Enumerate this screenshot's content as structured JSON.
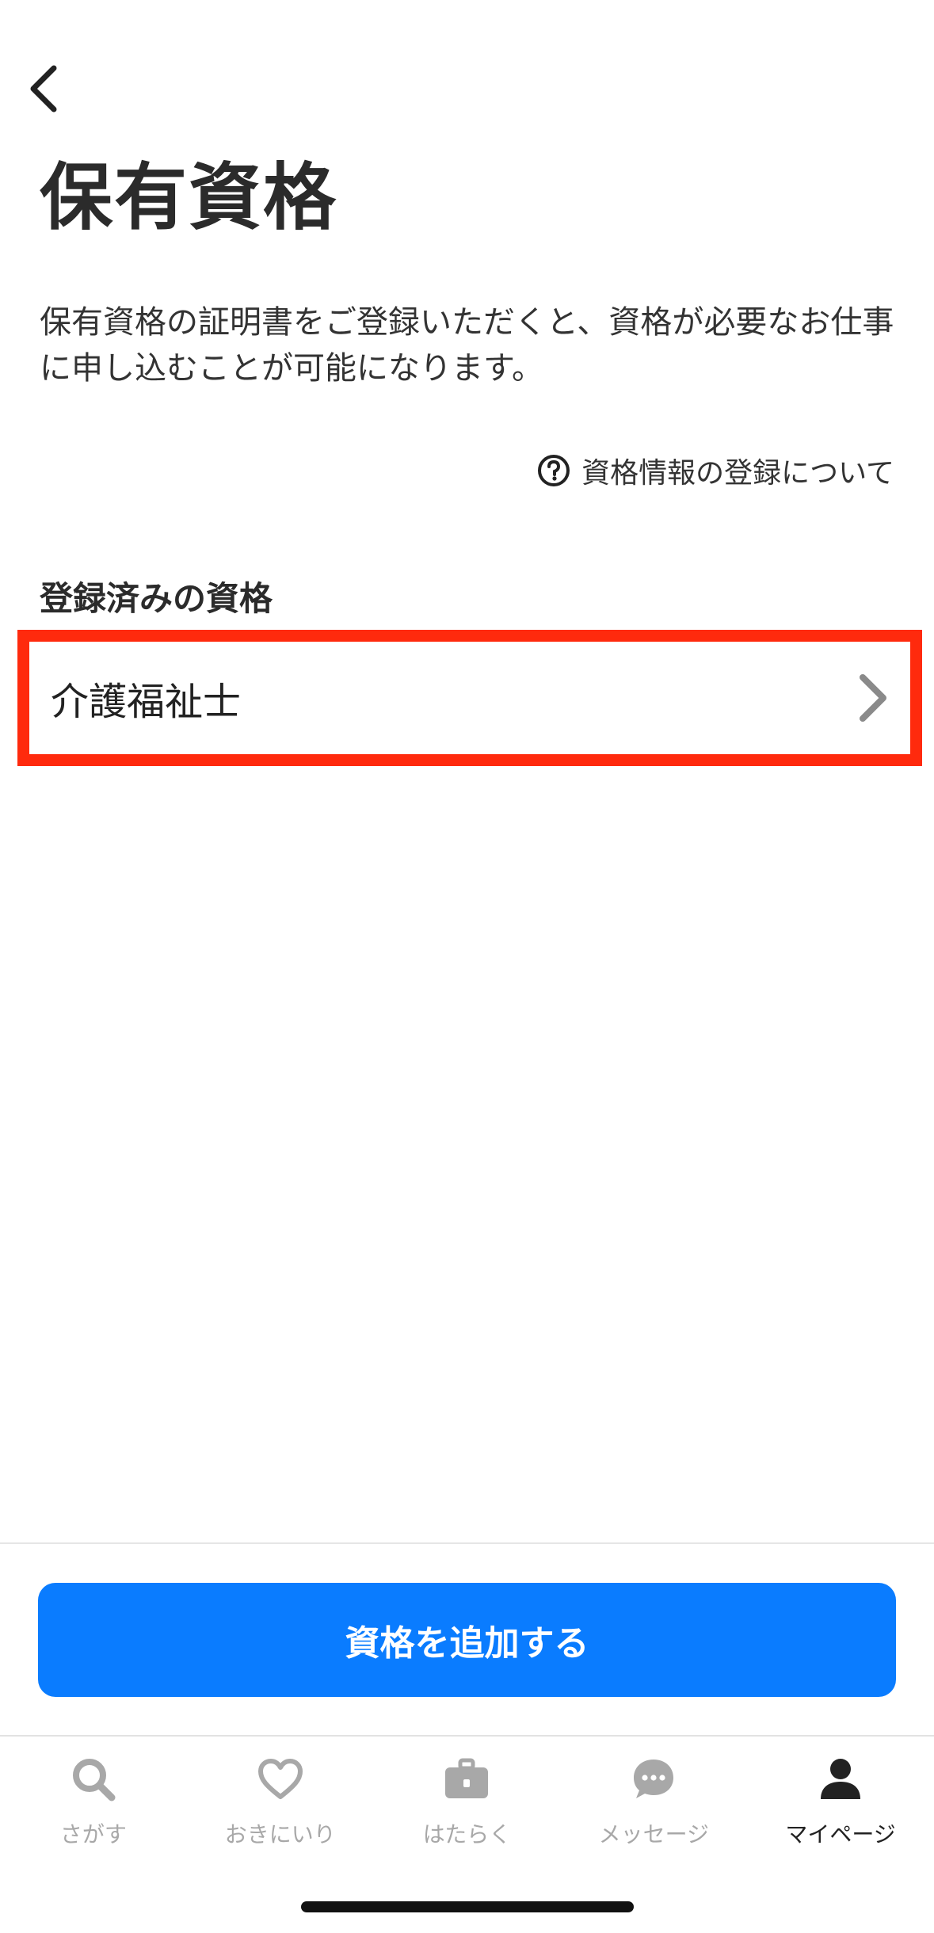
{
  "header": {
    "back_icon": "chevron-left-icon",
    "title": "保有資格"
  },
  "description": "保有資格の証明書をご登録いただくと、資格が必要なお仕事に申し込むことが可能になります。",
  "help_link": {
    "icon": "question-circle-icon",
    "label": "資格情報の登録について"
  },
  "registered": {
    "section_label": "登録済みの資格",
    "items": [
      {
        "label": "介護福祉士",
        "icon": "chevron-right-icon"
      }
    ]
  },
  "add_button": {
    "label": "資格を追加する"
  },
  "tabbar": {
    "tabs": [
      {
        "label": "さがす",
        "icon": "search-icon",
        "active": false
      },
      {
        "label": "おきにいり",
        "icon": "heart-icon",
        "active": false
      },
      {
        "label": "はたらく",
        "icon": "briefcase-icon",
        "active": false
      },
      {
        "label": "メッセージ",
        "icon": "message-bubble-icon",
        "active": false
      },
      {
        "label": "マイページ",
        "icon": "person-icon",
        "active": true
      }
    ]
  },
  "colors": {
    "accent": "#0a7cff",
    "highlight_border": "#ff2a0d",
    "inactive_tab": "#a8a8a8",
    "active_tab": "#222222"
  }
}
